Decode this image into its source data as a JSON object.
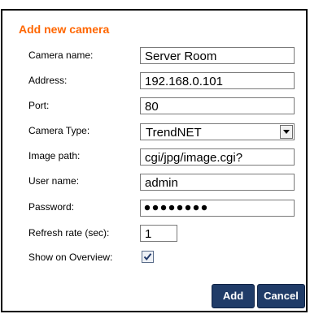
{
  "dialog": {
    "title": "Add new camera"
  },
  "fields": {
    "camera_name": {
      "label": "Camera name:",
      "value": "Server Room"
    },
    "address": {
      "label": "Address:",
      "value": "192.168.0.101"
    },
    "port": {
      "label": "Port:",
      "value": "80"
    },
    "camera_type": {
      "label": "Camera Type:",
      "value": "TrendNET"
    },
    "image_path": {
      "label": "Image path:",
      "value": "cgi/jpg/image.cgi?"
    },
    "user_name": {
      "label": "User name:",
      "value": "admin"
    },
    "password": {
      "label": "Password:",
      "masked_length": 8
    },
    "refresh_rate": {
      "label": "Refresh rate (sec):",
      "value": "1"
    },
    "show_on_overview": {
      "label": "Show on Overview:",
      "checked": true
    }
  },
  "buttons": {
    "add_label": "Add",
    "cancel_label": "Cancel"
  },
  "colors": {
    "title": "#ff6600",
    "button_bg": "#203c68",
    "border": "#000000"
  },
  "icons": {
    "select_arrow": "chevron-down-icon",
    "checkbox": "checkmark-icon"
  }
}
